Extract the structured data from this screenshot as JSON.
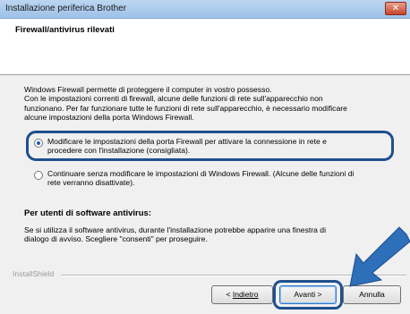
{
  "window": {
    "title": "Installazione periferica Brother",
    "close_glyph": "✕"
  },
  "header": {
    "title": "Firewall/antivirus rilevati"
  },
  "content": {
    "intro_lines": [
      "Windows Firewall permette di proteggere il computer in vostro possesso.",
      "Con le impostazioni correnti di firewall, alcune delle funzioni di rete sull'apparecchio non",
      "funzionano. Per far funzionare tutte le funzioni di rete sull'apparecchio, è necessario modificare",
      "alcune impostazioni della porta Windows Firewall."
    ],
    "options": [
      {
        "lines": [
          "Modificare le impostazioni della porta Firewall per attivare la connessione in rete e",
          "procedere con l'installazione (consigliata)."
        ],
        "selected": true
      },
      {
        "lines": [
          "Continuare senza modificare le impostazioni di Windows Firewall. (Alcune delle funzioni di",
          "rete verranno disattivate)."
        ],
        "selected": false
      }
    ]
  },
  "antivirus": {
    "title": "Per utenti di software antivirus:",
    "lines": [
      "Se si utilizza il software antivirus, durante l'installazione potrebbe apparire una finestra di",
      "dialogo di avviso. Scegliere \"consenti\" per proseguire."
    ]
  },
  "footer": {
    "installshield_label": "InstallShield",
    "back_prefix": "< ",
    "back_label": "Indietro",
    "next_label": "Avanti >",
    "cancel_label": "Annulla"
  },
  "colors": {
    "highlight": "#1f4f8f",
    "arrow": "#2d6fb8"
  }
}
